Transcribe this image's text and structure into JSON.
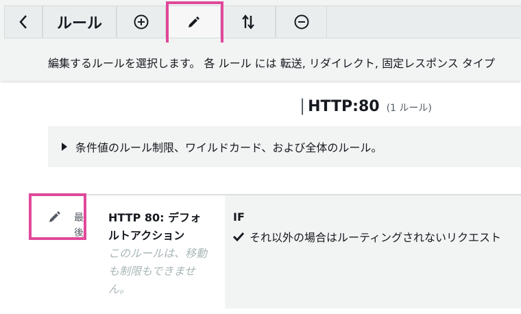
{
  "toolbar": {
    "back_icon": "chevron-left-icon",
    "rules_label": "ルール",
    "add_icon": "plus-circle-icon",
    "edit_icon": "pencil-icon",
    "reorder_icon": "sort-arrows-icon",
    "delete_icon": "minus-circle-icon",
    "highlight_color": "#e0489a"
  },
  "description": "編集するルールを選択します。 各 ルール には 転送, リダイレクト, 固定レスポンス タイプ",
  "listener": {
    "name": "HTTP:80",
    "count": "(1 ルール)"
  },
  "conditions_info": "条件値のルール制限、ワイルドカード、および全体のルール。",
  "rules": [
    {
      "priority": "最後",
      "name": "HTTP 80: デフォルトアクション",
      "note": "このルールは、移動も制限もできません。",
      "if_label": "IF",
      "condition": "それ以外の場合はルーティングされないリクエスト"
    }
  ]
}
